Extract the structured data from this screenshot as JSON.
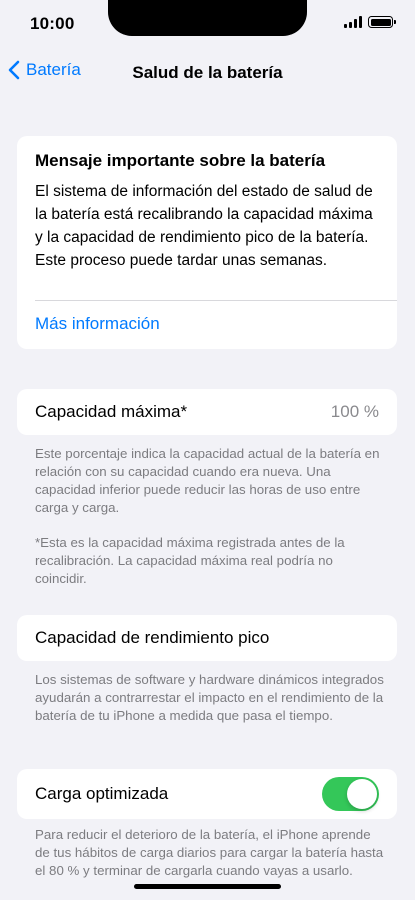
{
  "status": {
    "time": "10:00"
  },
  "nav": {
    "back_label": "Batería",
    "title": "Salud de la batería"
  },
  "message": {
    "title": "Mensaje importante sobre la batería",
    "body": "El sistema de información del estado de salud de la batería está recalibrando la capacidad máxima y la capacidad de rendimiento pico de la batería. Este proceso puede tardar unas semanas.",
    "link": "Más información"
  },
  "max_capacity": {
    "label": "Capacidad máxima*",
    "value": "100 %",
    "note1": "Este porcentaje indica la capacidad actual de la batería en relación con su capacidad cuando era nueva. Una capacidad inferior puede reducir las horas de uso entre carga y carga.",
    "note2": "*Esta es la capacidad máxima registrada antes de la recalibración. La capacidad máxima real podría no coincidir."
  },
  "peak": {
    "label": "Capacidad de rendimiento pico",
    "note": "Los sistemas de software y hardware dinámicos integrados ayudarán a contrarrestar el impacto en el rendimiento de la batería de tu iPhone a medida que pasa el tiempo."
  },
  "optimized": {
    "label": "Carga optimizada",
    "enabled": true,
    "note": "Para reducir el deterioro de la batería, el iPhone aprende de tus hábitos de carga diarios para cargar la batería hasta el 80 % y terminar de cargarla cuando vayas a usarlo."
  },
  "colors": {
    "accent": "#007aff",
    "toggle_on": "#34c759",
    "background": "#f2f2f7"
  }
}
